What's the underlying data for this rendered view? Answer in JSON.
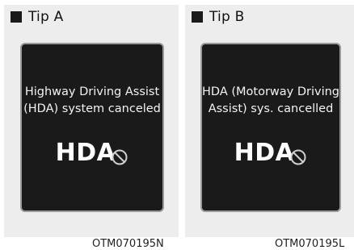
{
  "tips": [
    {
      "label": "Tip A",
      "message_lines": [
        "Highway Driving Assist",
        "(HDA) system canceled"
      ],
      "badge": "HDA",
      "figure_code": "OTM070195N"
    },
    {
      "label": "Tip B",
      "message_lines": [
        "HDA (Motorway Driving",
        "Assist) sys. cancelled"
      ],
      "badge": "HDA",
      "figure_code": "OTM070195L"
    }
  ],
  "icons": {
    "status": "cancelled-circle-icon",
    "bullet": "square-bullet"
  }
}
